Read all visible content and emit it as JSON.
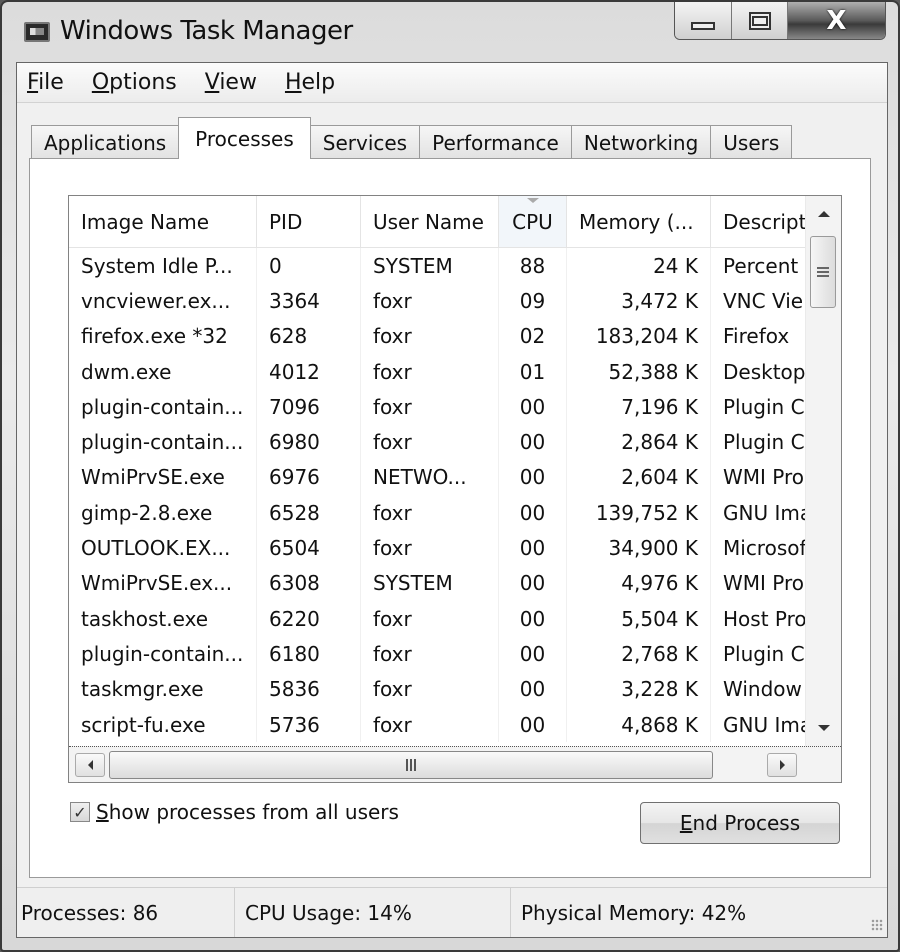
{
  "window": {
    "title": "Windows Task Manager",
    "app_icon": "task-manager-icon",
    "caption_buttons": {
      "minimize": "minimize-icon",
      "maximize": "maximize-icon",
      "close": "close-icon",
      "close_glyph": "X"
    }
  },
  "menu": [
    {
      "mnemonic": "F",
      "rest": "ile"
    },
    {
      "mnemonic": "O",
      "rest": "ptions"
    },
    {
      "mnemonic": "V",
      "rest": "iew"
    },
    {
      "mnemonic": "H",
      "rest": "elp"
    }
  ],
  "tabs": [
    {
      "label": "Applications",
      "active": false
    },
    {
      "label": "Processes",
      "active": true
    },
    {
      "label": "Services",
      "active": false
    },
    {
      "label": "Performance",
      "active": false
    },
    {
      "label": "Networking",
      "active": false
    },
    {
      "label": "Users",
      "active": false
    }
  ],
  "processes": {
    "columns": [
      "Image Name",
      "PID",
      "User Name",
      "CPU",
      "Memory (...",
      "Descript"
    ],
    "sorted_column": "CPU",
    "rows": [
      {
        "name": "System Idle P...",
        "pid": "0",
        "user": "SYSTEM",
        "cpu": "88",
        "mem": "24 K",
        "desc": "Percent"
      },
      {
        "name": "vncviewer.ex...",
        "pid": "3364",
        "user": "foxr",
        "cpu": "09",
        "mem": "3,472 K",
        "desc": "VNC Vie"
      },
      {
        "name": "firefox.exe *32",
        "pid": "628",
        "user": "foxr",
        "cpu": "02",
        "mem": "183,204 K",
        "desc": "Firefox"
      },
      {
        "name": "dwm.exe",
        "pid": "4012",
        "user": "foxr",
        "cpu": "01",
        "mem": "52,388 K",
        "desc": "Desktop"
      },
      {
        "name": "plugin-contain...",
        "pid": "7096",
        "user": "foxr",
        "cpu": "00",
        "mem": "7,196 K",
        "desc": "Plugin C"
      },
      {
        "name": "plugin-contain...",
        "pid": "6980",
        "user": "foxr",
        "cpu": "00",
        "mem": "2,864 K",
        "desc": "Plugin C"
      },
      {
        "name": "WmiPrvSE.exe",
        "pid": "6976",
        "user": "NETWO...",
        "cpu": "00",
        "mem": "2,604 K",
        "desc": "WMI Pro"
      },
      {
        "name": "gimp-2.8.exe",
        "pid": "6528",
        "user": "foxr",
        "cpu": "00",
        "mem": "139,752 K",
        "desc": "GNU Ima"
      },
      {
        "name": "OUTLOOK.EX...",
        "pid": "6504",
        "user": "foxr",
        "cpu": "00",
        "mem": "34,900 K",
        "desc": "Microsof"
      },
      {
        "name": "WmiPrvSE.ex...",
        "pid": "6308",
        "user": "SYSTEM",
        "cpu": "00",
        "mem": "4,976 K",
        "desc": "WMI Pro"
      },
      {
        "name": "taskhost.exe",
        "pid": "6220",
        "user": "foxr",
        "cpu": "00",
        "mem": "5,504 K",
        "desc": "Host Pro"
      },
      {
        "name": "plugin-contain...",
        "pid": "6180",
        "user": "foxr",
        "cpu": "00",
        "mem": "2,768 K",
        "desc": "Plugin C"
      },
      {
        "name": "taskmgr.exe",
        "pid": "5836",
        "user": "foxr",
        "cpu": "00",
        "mem": "3,228 K",
        "desc": "Window"
      },
      {
        "name": "script-fu.exe",
        "pid": "5736",
        "user": "foxr",
        "cpu": "00",
        "mem": "4,868 K",
        "desc": "GNU Ima"
      }
    ]
  },
  "show_all_users": {
    "checked": true,
    "check_glyph": "✓",
    "mnemonic": "S",
    "rest": "how processes from all users"
  },
  "end_process": {
    "mnemonic": "E",
    "rest": "nd Process"
  },
  "status": {
    "processes": "Processes: 86",
    "cpu": "CPU Usage: 14%",
    "memory": "Physical Memory: 42%"
  }
}
